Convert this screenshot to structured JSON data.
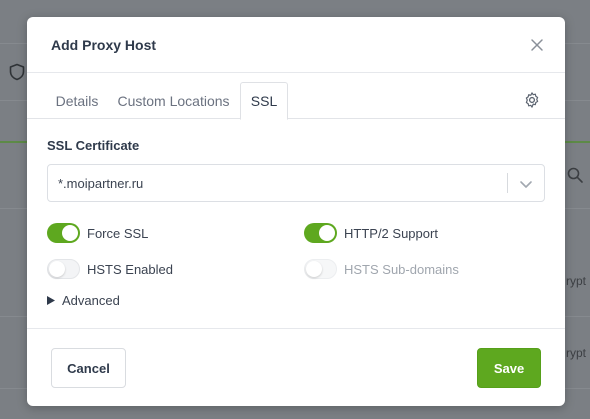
{
  "background": {
    "partial_texts": [
      "rypt",
      "rypt"
    ]
  },
  "modal": {
    "title": "Add Proxy Host",
    "tabs": [
      {
        "label": "Details",
        "active": false
      },
      {
        "label": "Custom Locations",
        "active": false
      },
      {
        "label": "SSL",
        "active": true
      }
    ],
    "ssl": {
      "certificate_label": "SSL Certificate",
      "certificate_value": "*.moipartner.ru",
      "toggles": {
        "force_ssl": {
          "label": "Force SSL",
          "state": "on"
        },
        "http2": {
          "label": "HTTP/2 Support",
          "state": "on"
        },
        "hsts": {
          "label": "HSTS Enabled",
          "state": "off"
        },
        "hsts_sub": {
          "label": "HSTS Sub-domains",
          "state": "disabled"
        }
      },
      "advanced_label": "Advanced"
    },
    "footer": {
      "cancel_label": "Cancel",
      "save_label": "Save"
    }
  },
  "colors": {
    "accent": "#5ea81f",
    "overlay": "#7b7f84"
  },
  "icons": [
    "shield-icon",
    "search-icon",
    "close-icon",
    "gear-icon",
    "chevron-down-icon",
    "caret-right-icon"
  ]
}
